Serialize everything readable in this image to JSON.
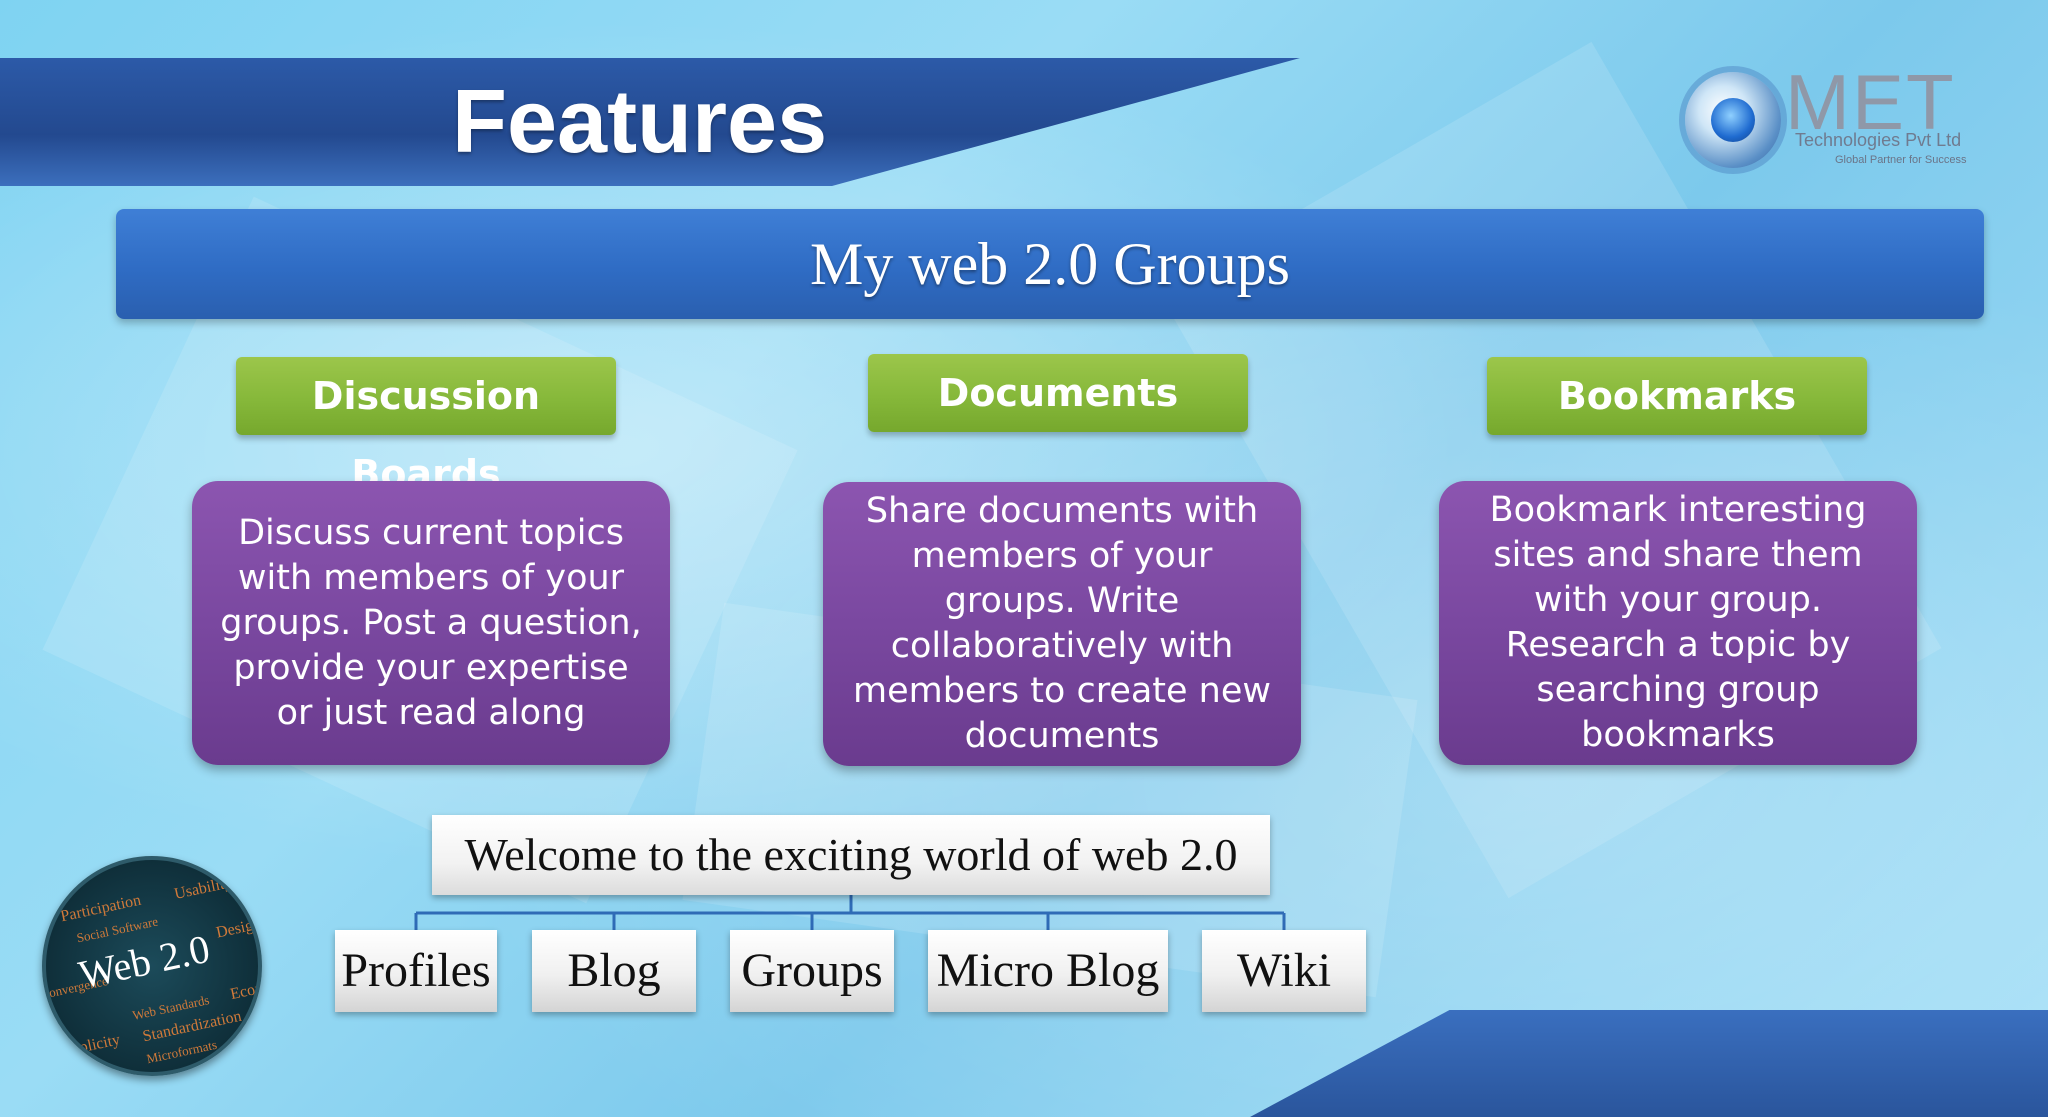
{
  "slide": {
    "title": "Features",
    "subtitle": "My web 2.0 Groups"
  },
  "logo": {
    "name": "MET",
    "company": "Technologies Pvt Ltd",
    "tagline": "Global Partner for Success"
  },
  "features": [
    {
      "label": "Discussion Boards",
      "description": "Discuss current topics with members of your groups. Post a question, provide your expertise or just read along"
    },
    {
      "label": "Documents",
      "description": "Share documents with members of your groups. Write collaboratively with members to create new documents"
    },
    {
      "label": "Bookmarks",
      "description": "Bookmark interesting sites and share them with your group. Research a topic by searching group bookmarks"
    }
  ],
  "hierarchy": {
    "root": "Welcome to the exciting world of web 2.0",
    "children": [
      "Profiles",
      "Blog",
      "Groups",
      "Micro Blog",
      "Wiki"
    ]
  },
  "badge": {
    "text": "Web 2.0",
    "words": [
      "Participation",
      "Usability",
      "Social Software",
      "Design",
      "Convergence",
      "Web Standards",
      "Standardization",
      "Economy",
      "Microformats",
      "Simplicity"
    ]
  },
  "colors": {
    "header_blue": "#23498f",
    "subtitle_blue": "#2f6cc4",
    "feature_green": "#86b83a",
    "feature_purple": "#7a48a0"
  }
}
